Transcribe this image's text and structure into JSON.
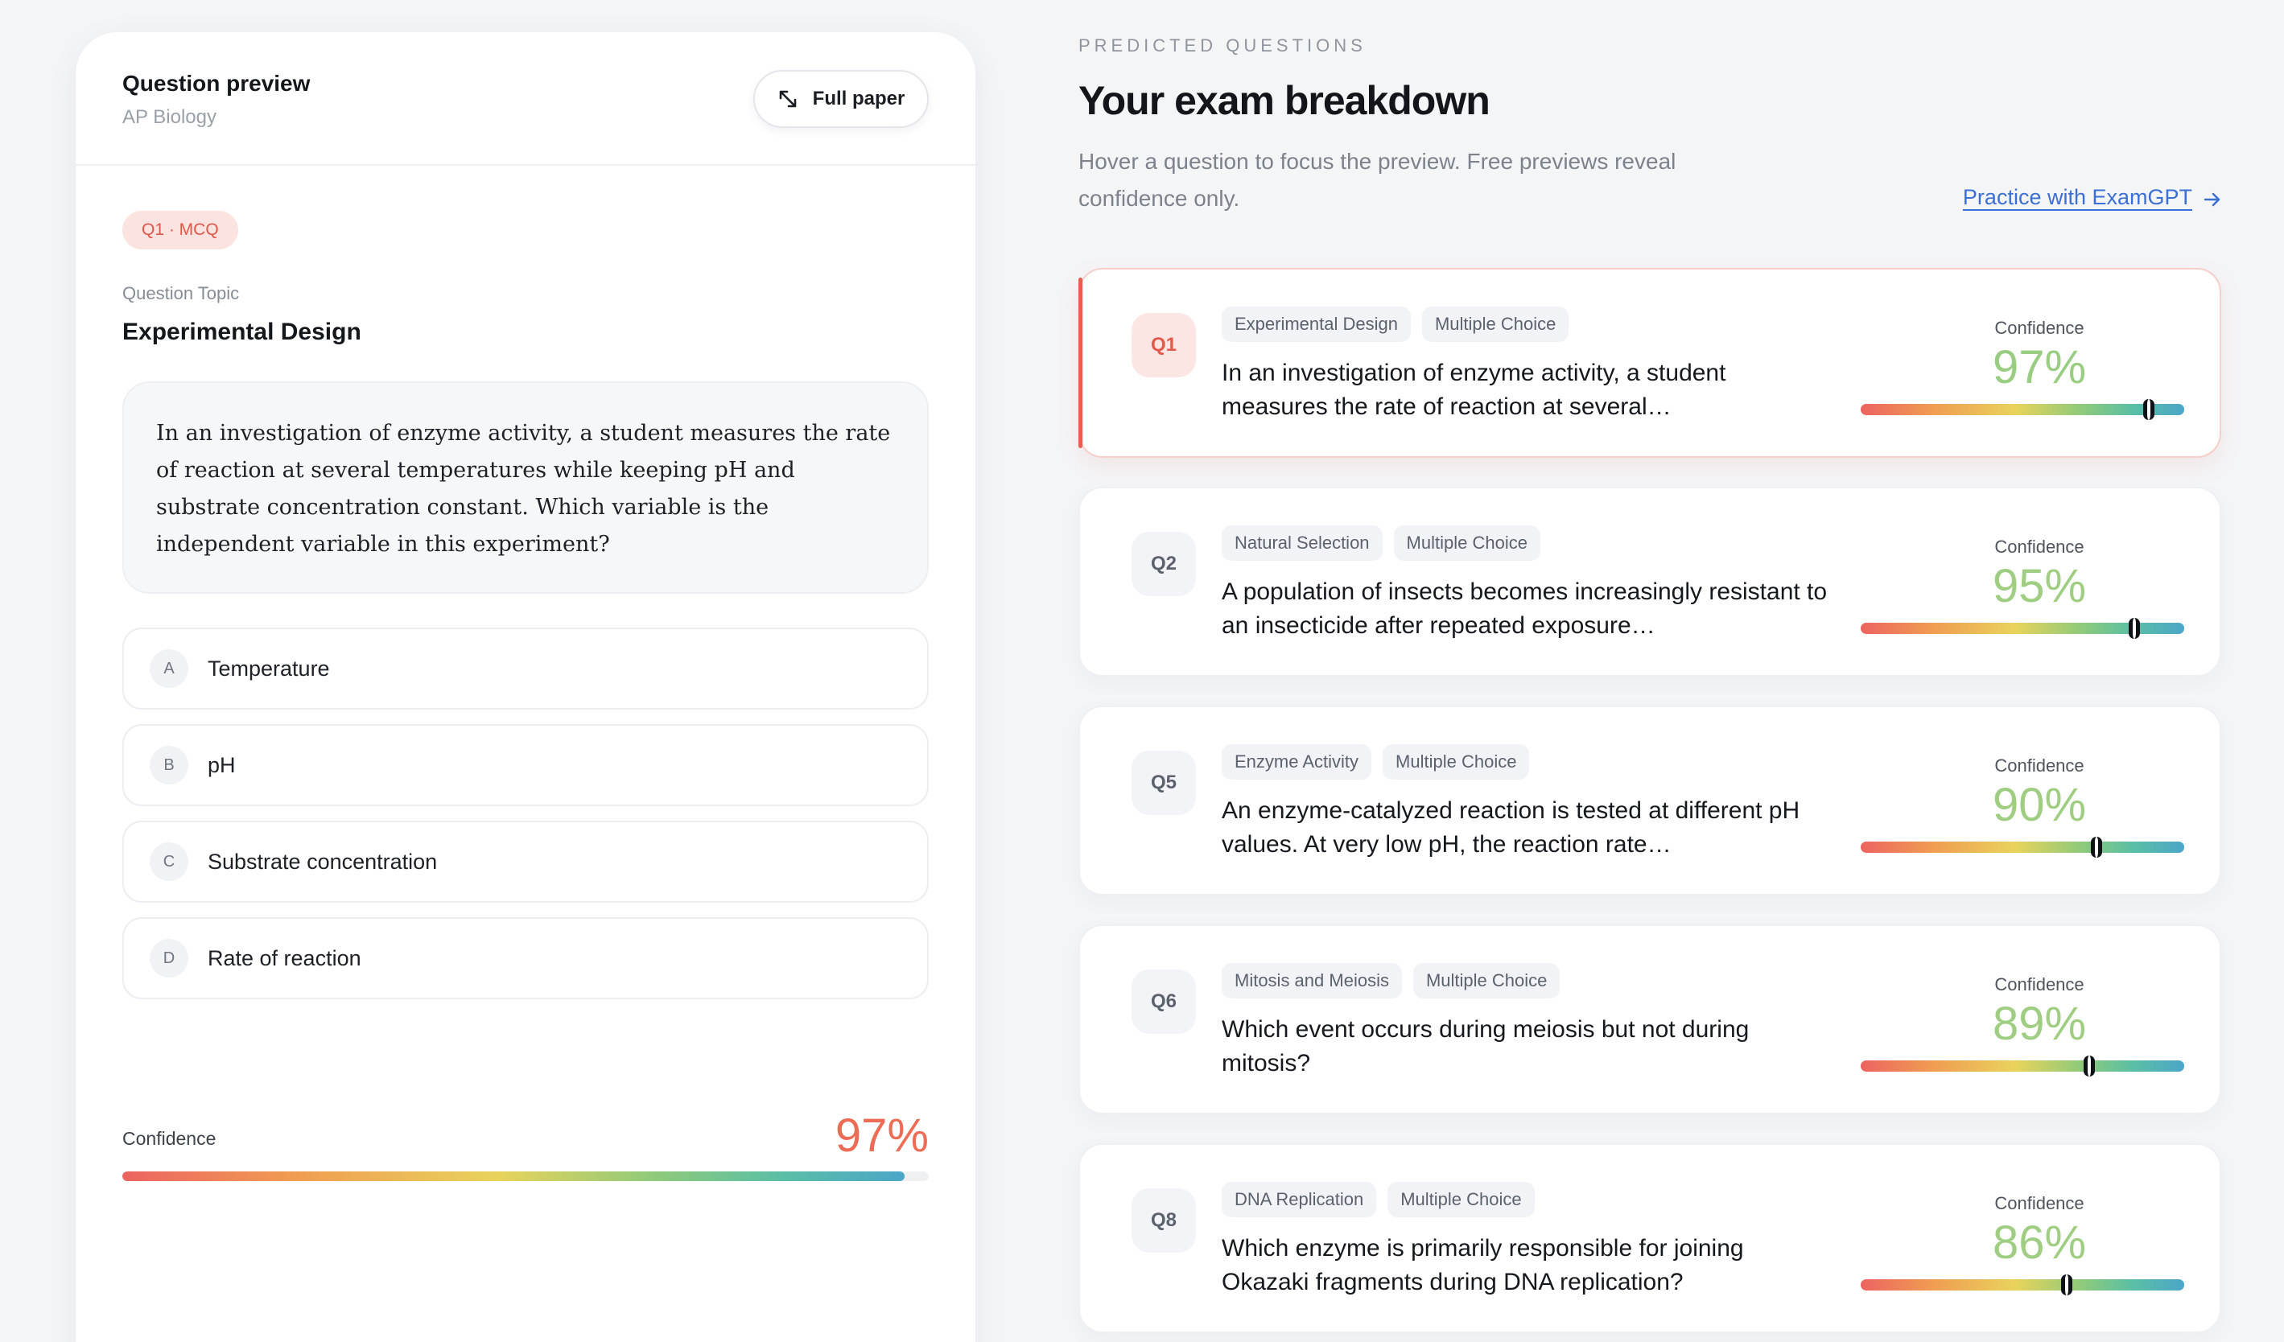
{
  "preview": {
    "title": "Question preview",
    "subject": "AP Biology",
    "full_paper_label": "Full paper",
    "badge": "Q1 · MCQ",
    "topic_label": "Question Topic",
    "topic": "Experimental Design",
    "question": "In an investigation of enzyme activity, a student measures the rate of reaction at several temperatures while keeping pH and substrate concentration constant. Which variable is the independent variable in this experiment?",
    "options": [
      {
        "letter": "A",
        "text": "Temperature"
      },
      {
        "letter": "B",
        "text": "pH"
      },
      {
        "letter": "C",
        "text": "Substrate concentration"
      },
      {
        "letter": "D",
        "text": "Rate of reaction"
      }
    ],
    "confidence_label": "Confidence",
    "confidence_value": "97%",
    "confidence_fraction": 0.97
  },
  "header": {
    "eyebrow": "PREDICTED QUESTIONS",
    "title": "Your exam breakdown",
    "intro": "Hover a question to focus the preview. Free previews reveal confidence only.",
    "practice_link": "Practice with ExamGPT"
  },
  "questions": [
    {
      "num": "Q1",
      "tags": [
        "Experimental Design",
        "Multiple Choice"
      ],
      "text": "In an investigation of enzyme activity, a student measures the rate of reaction at several…",
      "confidence_label": "Confidence",
      "confidence": "97%",
      "fraction": 0.97,
      "active": true
    },
    {
      "num": "Q2",
      "tags": [
        "Natural Selection",
        "Multiple Choice"
      ],
      "text": "A population of insects becomes increasingly resistant to an insecticide after repeated exposure…",
      "confidence_label": "Confidence",
      "confidence": "95%",
      "fraction": 0.95,
      "active": false
    },
    {
      "num": "Q5",
      "tags": [
        "Enzyme Activity",
        "Multiple Choice"
      ],
      "text": "An enzyme-catalyzed reaction is tested at different pH values. At very low pH, the reaction rate…",
      "confidence_label": "Confidence",
      "confidence": "90%",
      "fraction": 0.9,
      "active": false
    },
    {
      "num": "Q6",
      "tags": [
        "Mitosis and Meiosis",
        "Multiple Choice"
      ],
      "text": "Which event occurs during meiosis but not during mitosis?",
      "confidence_label": "Confidence",
      "confidence": "89%",
      "fraction": 0.89,
      "active": false
    },
    {
      "num": "Q8",
      "tags": [
        "DNA Replication",
        "Multiple Choice"
      ],
      "text": "Which enzyme is primarily responsible for joining Okazaki fragments during DNA replication?",
      "confidence_label": "Confidence",
      "confidence": "86%",
      "fraction": 0.86,
      "active": false
    }
  ],
  "colors": {
    "accent_red": "#e25a4c",
    "confidence_green": "#9fce83",
    "link_blue": "#3b6fd6"
  },
  "icons": {
    "full_paper": "expand-icon",
    "practice": "arrow-right-icon"
  }
}
